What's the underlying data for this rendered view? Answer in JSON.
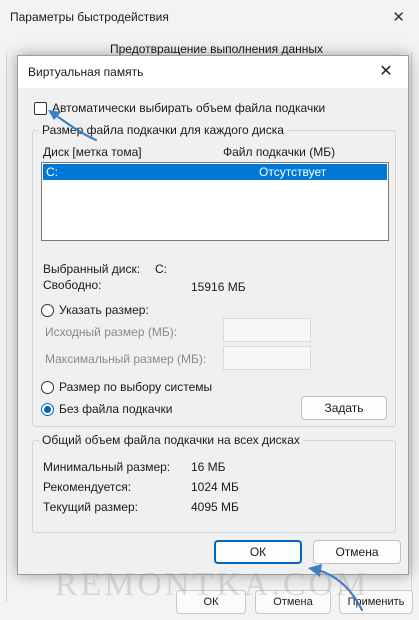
{
  "background_window": {
    "title": "Параметры быстродействия",
    "close_glyph": "✕",
    "tab_label": "Предотвращение выполнения данных",
    "ok_label": "ОК",
    "cancel_label": "Отмена",
    "apply_label": "Применить"
  },
  "dialog": {
    "title": "Виртуальная память",
    "close_glyph": "✕",
    "auto_manage_label": "Автоматически выбирать объем файла подкачки",
    "auto_manage_checked": false,
    "drives_group": {
      "legend": "Размер файла подкачки для каждого диска",
      "columns": [
        "Диск [метка тома]",
        "Файл подкачки (МБ)"
      ],
      "rows": [
        {
          "disk": "C:",
          "paging_file": "Отсутствует",
          "selected": true
        }
      ],
      "selected_disk_label": "Выбранный диск:",
      "selected_disk_value": "C:",
      "free_label": "Свободно:",
      "free_value": "15916 МБ",
      "custom_size_label": "Указать размер:",
      "initial_size_label": "Исходный размер (МБ):",
      "initial_size_value": "",
      "max_size_label": "Максимальный размер (МБ):",
      "max_size_value": "",
      "system_managed_label": "Размер по выбору системы",
      "no_paging_label": "Без файла подкачки",
      "selected_option": "no_paging",
      "set_label": "Задать"
    },
    "total_group": {
      "legend": "Общий объем файла подкачки на всех дисках",
      "min_label": "Минимальный размер:",
      "min_value": "16 МБ",
      "recommended_label": "Рекомендуется:",
      "recommended_value": "1024 МБ",
      "current_label": "Текущий размер:",
      "current_value": "4095 МБ"
    },
    "ok_label": "ОК",
    "cancel_label": "Отмена"
  },
  "watermark_text": "REMONTKA.COM",
  "colors": {
    "accent": "#0067c0",
    "selection": "#0078d7",
    "annotation_arrow": "#3b7fc4"
  }
}
